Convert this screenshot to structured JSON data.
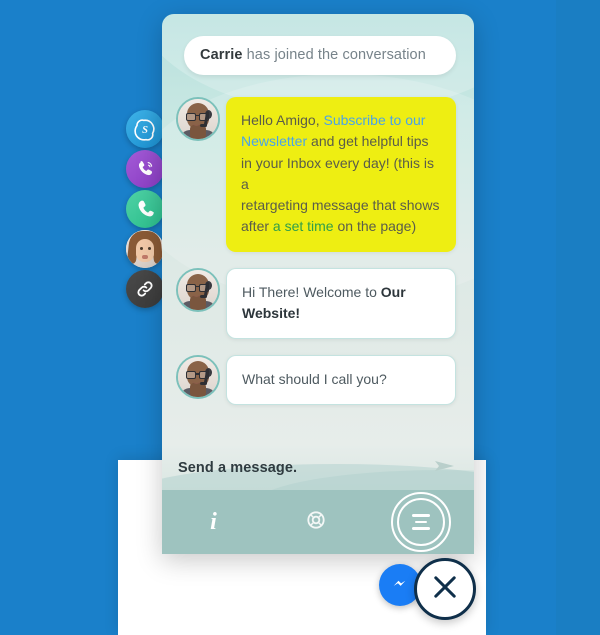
{
  "theme": {
    "page_background": "#1a80ca",
    "widget_background_top": "#b6e0dd",
    "widget_background_bottom": "#e7edea",
    "bottom_nav": "#9ec3bf",
    "highlight_bubble": "#eeee12",
    "link_blue": "#4aa3e8",
    "link_green": "#2f9e4a",
    "messenger_blue": "#1a7df5",
    "close_outline": "#0f2f4a"
  },
  "social_rail": {
    "items": [
      {
        "name": "skype",
        "icon": "skype-icon",
        "label": "Skype",
        "color": "#1a8fd0"
      },
      {
        "name": "viber",
        "icon": "viber-icon",
        "label": "Viber",
        "color": "#8a3cc4"
      },
      {
        "name": "phone",
        "icon": "phone-icon",
        "label": "Call",
        "color": "#2bbf8c"
      },
      {
        "name": "agent",
        "icon": "avatar-icon",
        "label": "Carrie",
        "color": "#ffffff"
      },
      {
        "name": "copy-link",
        "icon": "link-icon",
        "label": "Copy link",
        "color": "#3a3a3a"
      }
    ]
  },
  "header": {
    "who": "Carrie",
    "rest": " has joined the conversation"
  },
  "messages": [
    {
      "id": "promo",
      "style": "yellow",
      "avatar": "operator-avatar",
      "parts": [
        {
          "text": "Hello Amigo, ",
          "style": "plain"
        },
        {
          "text": "Subscribe to our Newsletter",
          "style": "link-blue"
        },
        {
          "text": " and get helpful tips in your Inbox every day! (this is a",
          "style": "plain"
        },
        {
          "text": "\n",
          "style": "break"
        },
        {
          "text": "retargeting message that shows after ",
          "style": "plain"
        },
        {
          "text": "a set time",
          "style": "link-green"
        },
        {
          "text": " on the page)",
          "style": "plain"
        }
      ]
    },
    {
      "id": "welcome",
      "style": "white",
      "avatar": "operator-avatar",
      "parts": [
        {
          "text": "Hi There! Welcome to ",
          "style": "plain"
        },
        {
          "text": "Our Website!",
          "style": "bold"
        }
      ]
    },
    {
      "id": "ask-name",
      "style": "white",
      "avatar": "operator-avatar",
      "parts": [
        {
          "text": "What should I call you?",
          "style": "plain"
        }
      ]
    }
  ],
  "composer": {
    "placeholder": "Send a message.",
    "value": "",
    "send_icon": "send-arrow-icon"
  },
  "bottom_nav": {
    "items": [
      {
        "name": "info",
        "icon": "info-icon",
        "label": "i"
      },
      {
        "name": "help",
        "icon": "lifebuoy-icon",
        "label": ""
      },
      {
        "name": "menu",
        "icon": "hamburger-icon",
        "label": ""
      }
    ]
  },
  "fabs": {
    "messenger": {
      "icon": "facebook-messenger-icon",
      "label": "Messenger"
    },
    "close": {
      "icon": "close-x-icon",
      "label": "Close"
    }
  }
}
